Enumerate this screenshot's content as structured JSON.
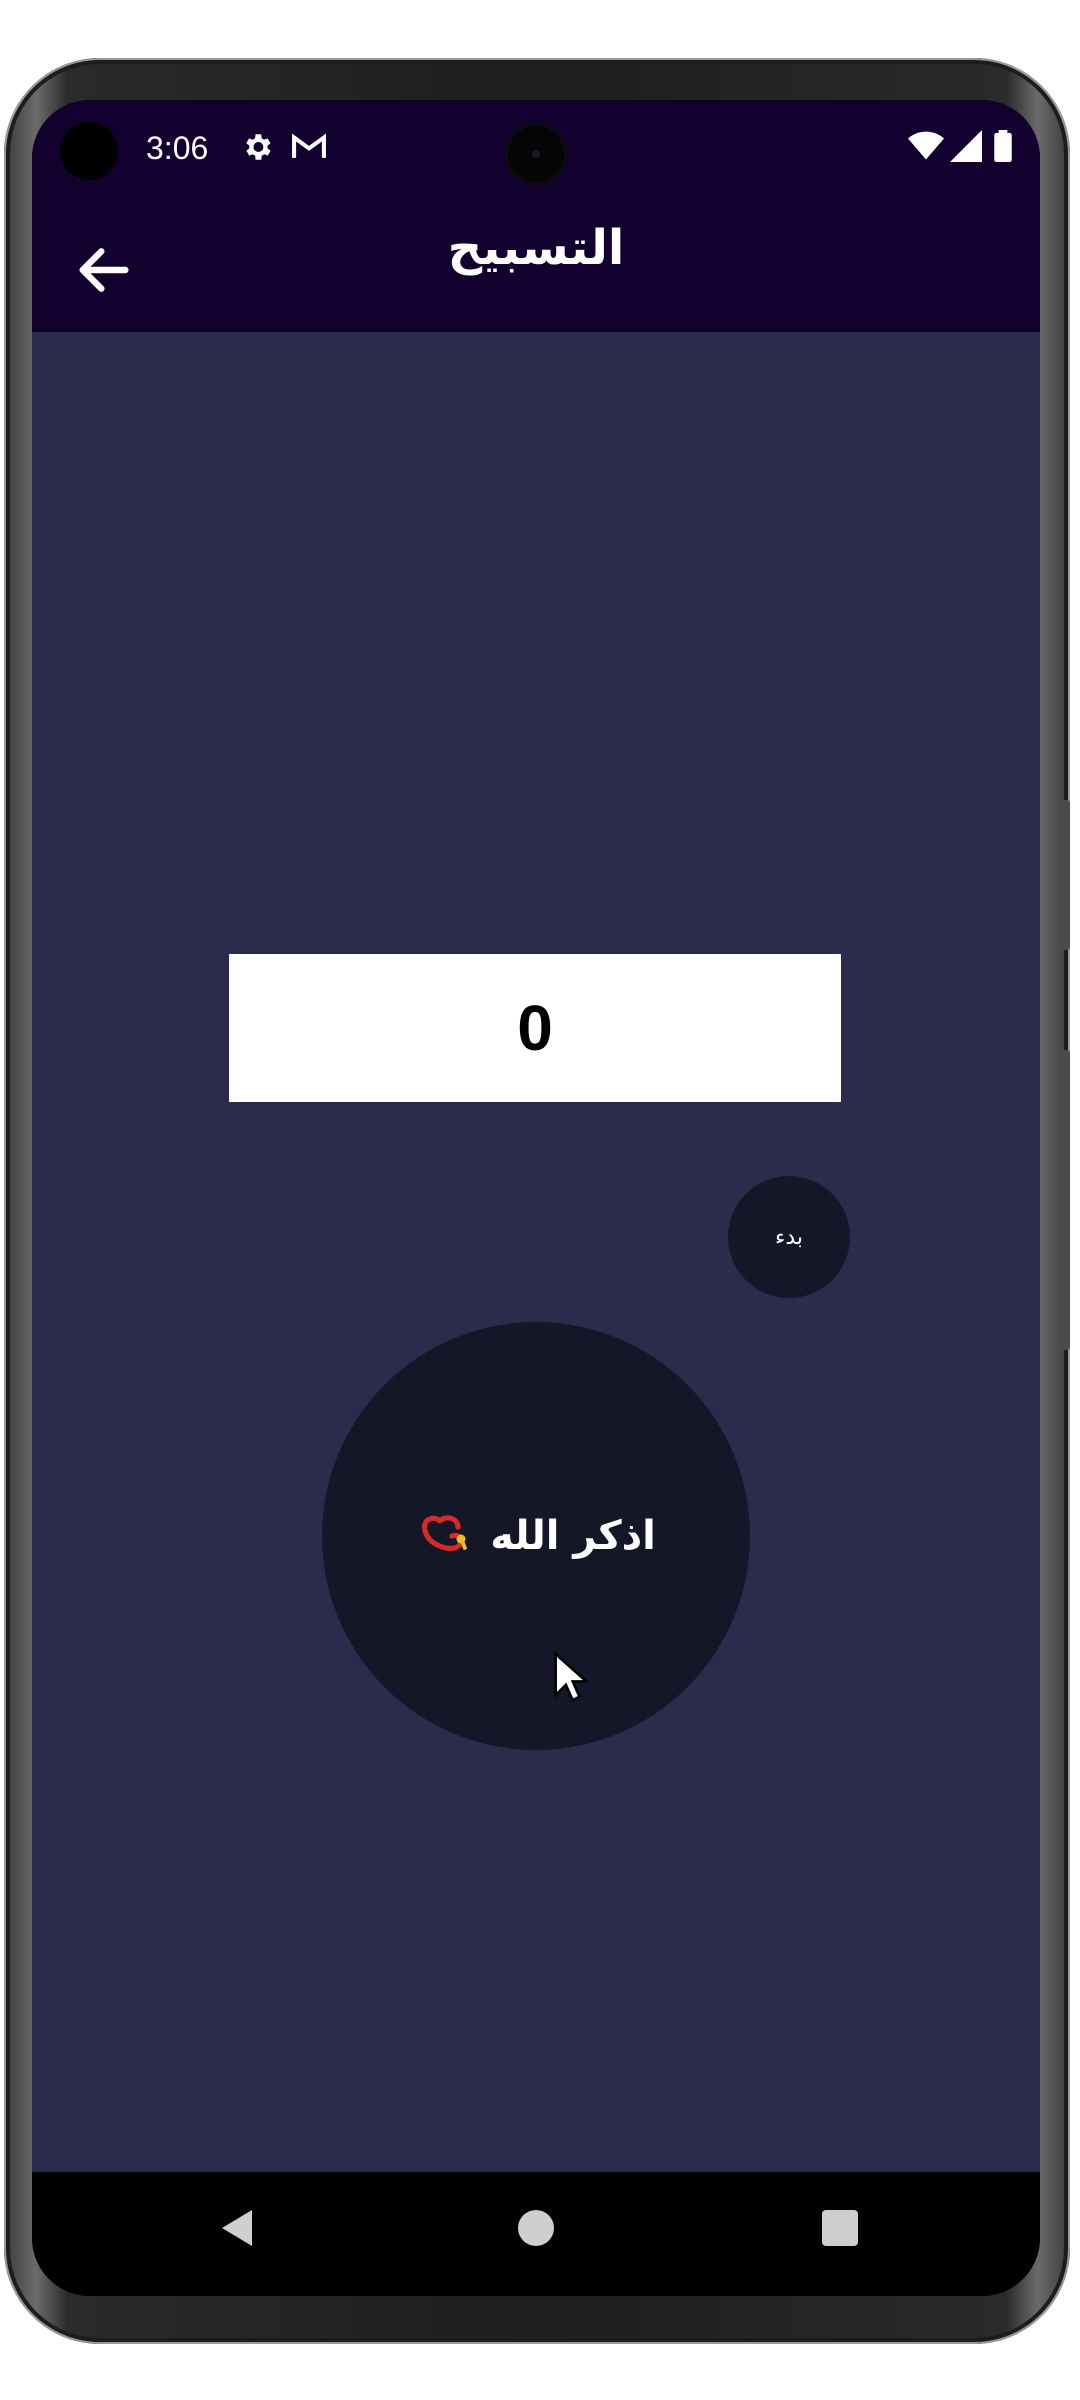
{
  "status_bar": {
    "time": "3:06",
    "icons": [
      "settings-gear-icon",
      "gmail-icon",
      "wifi-icon",
      "signal-icon",
      "battery-icon"
    ]
  },
  "app_bar": {
    "title": "التسبيح",
    "back_icon": "arrow-left-icon"
  },
  "counter": {
    "value": "0"
  },
  "reset_button": {
    "label": "بدء"
  },
  "dhikr_button": {
    "label": "اذكر الله",
    "icon": "prayer-beads-icon"
  },
  "nav_bar": {
    "icons": [
      "nav-back-icon",
      "nav-home-icon",
      "nav-recents-icon"
    ]
  },
  "colors": {
    "app_bar_bg": "#12002e",
    "content_bg": "#2d2b4b",
    "button_bg": "#151628",
    "counter_bg": "#ffffff"
  }
}
